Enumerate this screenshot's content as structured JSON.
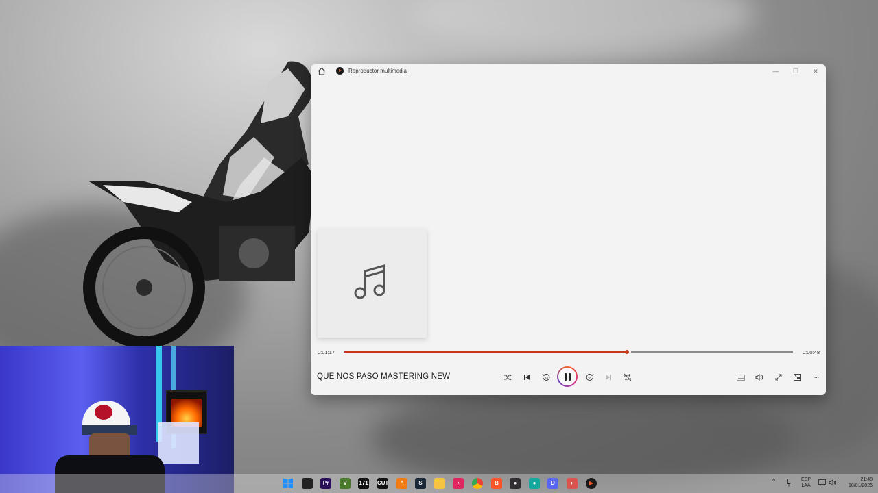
{
  "window": {
    "title": "Reproductor multimedia",
    "minimize": "—",
    "maximize": "☐",
    "close": "✕"
  },
  "player": {
    "elapsed": "0:01:17",
    "remaining": "0:00:48",
    "progress_fraction": 0.63,
    "track_title": "QUE NOS PASO MASTERING NEW",
    "state": "playing"
  },
  "colors": {
    "accent": "#c4381b",
    "window_bg": "#f3f3f3"
  },
  "controls": {
    "shuffle": "shuffle-icon",
    "previous": "previous-icon",
    "rewind": "rewind-10-icon",
    "play_pause": "pause-icon",
    "forward": "forward-30-icon",
    "next": "next-icon",
    "repeat": "repeat-off-icon",
    "captions": "captions-icon",
    "volume": "volume-icon",
    "fullscreen": "fullscreen-icon",
    "mini": "miniplayer-icon",
    "more": "···"
  },
  "taskbar": {
    "pinned": [
      {
        "name": "windows-start-icon",
        "label": "",
        "color": "#1e90ff"
      },
      {
        "name": "task-view-icon",
        "label": "",
        "color": "#222222"
      },
      {
        "name": "premiere-icon",
        "label": "Pr",
        "color": "#2a0f5a"
      },
      {
        "name": "app-v-icon",
        "label": "V",
        "color": "#4a7a2c"
      },
      {
        "name": "app-171-icon",
        "label": "171",
        "color": "#111111"
      },
      {
        "name": "capcut-icon",
        "label": "CUT",
        "color": "#111111"
      },
      {
        "name": "fl-studio-icon",
        "label": "/\\",
        "color": "#f07a16"
      },
      {
        "name": "steam-icon",
        "label": "S",
        "color": "#1b2838"
      },
      {
        "name": "file-explorer-icon",
        "label": "",
        "color": "#f5c542"
      },
      {
        "name": "tiktok-icon",
        "label": "♪",
        "color": "#e0245e"
      },
      {
        "name": "chrome-icon",
        "label": "",
        "color": "#34a853"
      },
      {
        "name": "brave-icon",
        "label": "B",
        "color": "#fb542b"
      },
      {
        "name": "obs-icon",
        "label": "●",
        "color": "#302e31"
      },
      {
        "name": "app-green-icon",
        "label": "●",
        "color": "#13a89e"
      },
      {
        "name": "discord-icon",
        "label": "D",
        "color": "#5865f2"
      },
      {
        "name": "app-red-icon",
        "label": "◐",
        "color": "#d9534f"
      },
      {
        "name": "media-player-icon",
        "label": "▶",
        "color": "#1a1a1a"
      }
    ],
    "language_top": "ESP",
    "language_bottom": "LAA",
    "time": "21:48",
    "date": "18/01/2026"
  }
}
